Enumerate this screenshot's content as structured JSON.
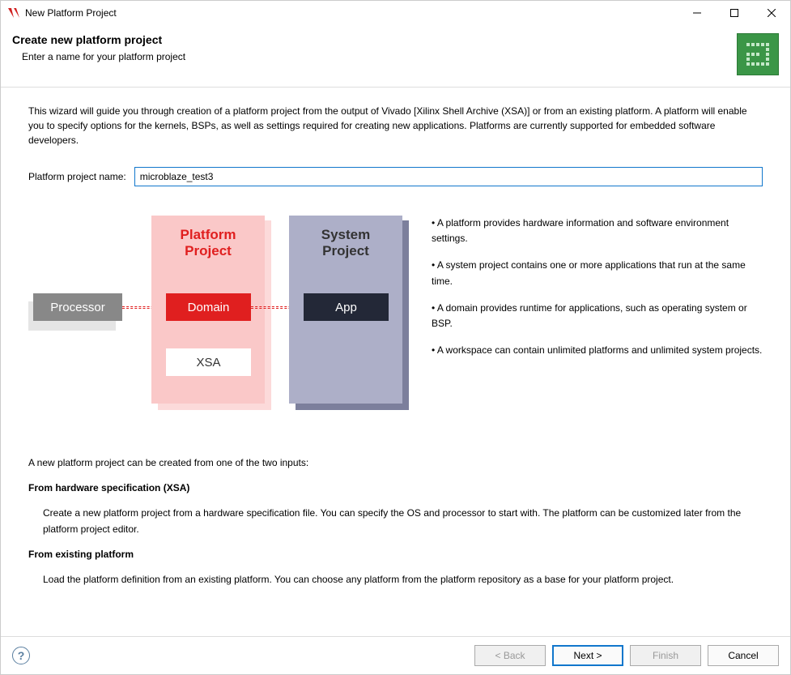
{
  "titlebar": {
    "title": "New Platform Project"
  },
  "header": {
    "title": "Create new platform project",
    "subtitle": "Enter a name for your platform project"
  },
  "intro": "This wizard will guide you through creation of a platform project from the output of Vivado [Xilinx Shell Archive (XSA)] or from an existing platform. A platform will enable you to specify options for the kernels, BSPs, as well as settings required for creating new applications. Platforms are currently supported for embedded software developers.",
  "form": {
    "name_label": "Platform project name:",
    "name_value": "microblaze_test3"
  },
  "diagram": {
    "processor": "Processor",
    "platform_title_l1": "Platform",
    "platform_title_l2": "Project",
    "domain": "Domain",
    "xsa": "XSA",
    "system_title_l1": "System",
    "system_title_l2": "Project",
    "app": "App"
  },
  "bullets": {
    "b1": "• A platform provides hardware information and software environment settings.",
    "b2": "• A system project contains one or more applications that run at the same time.",
    "b3": "• A domain provides runtime for applications, such as operating system or BSP.",
    "b4": "• A workspace can contain unlimited platforms and unlimited system projects."
  },
  "inputs": {
    "intro": "A new platform project can be created from one of the two inputs:",
    "xsa_heading": "From hardware specification (XSA)",
    "xsa_body": "Create a new platform project from a hardware specification file. You can specify the OS and processor to start with. The platform can be customized later from the platform project editor.",
    "existing_heading": "From existing platform",
    "existing_body": "Load the platform definition from an existing platform. You can choose any platform from the platform repository as a base for your platform project."
  },
  "footer": {
    "help": "?",
    "back": "< Back",
    "next": "Next >",
    "finish": "Finish",
    "cancel": "Cancel"
  }
}
